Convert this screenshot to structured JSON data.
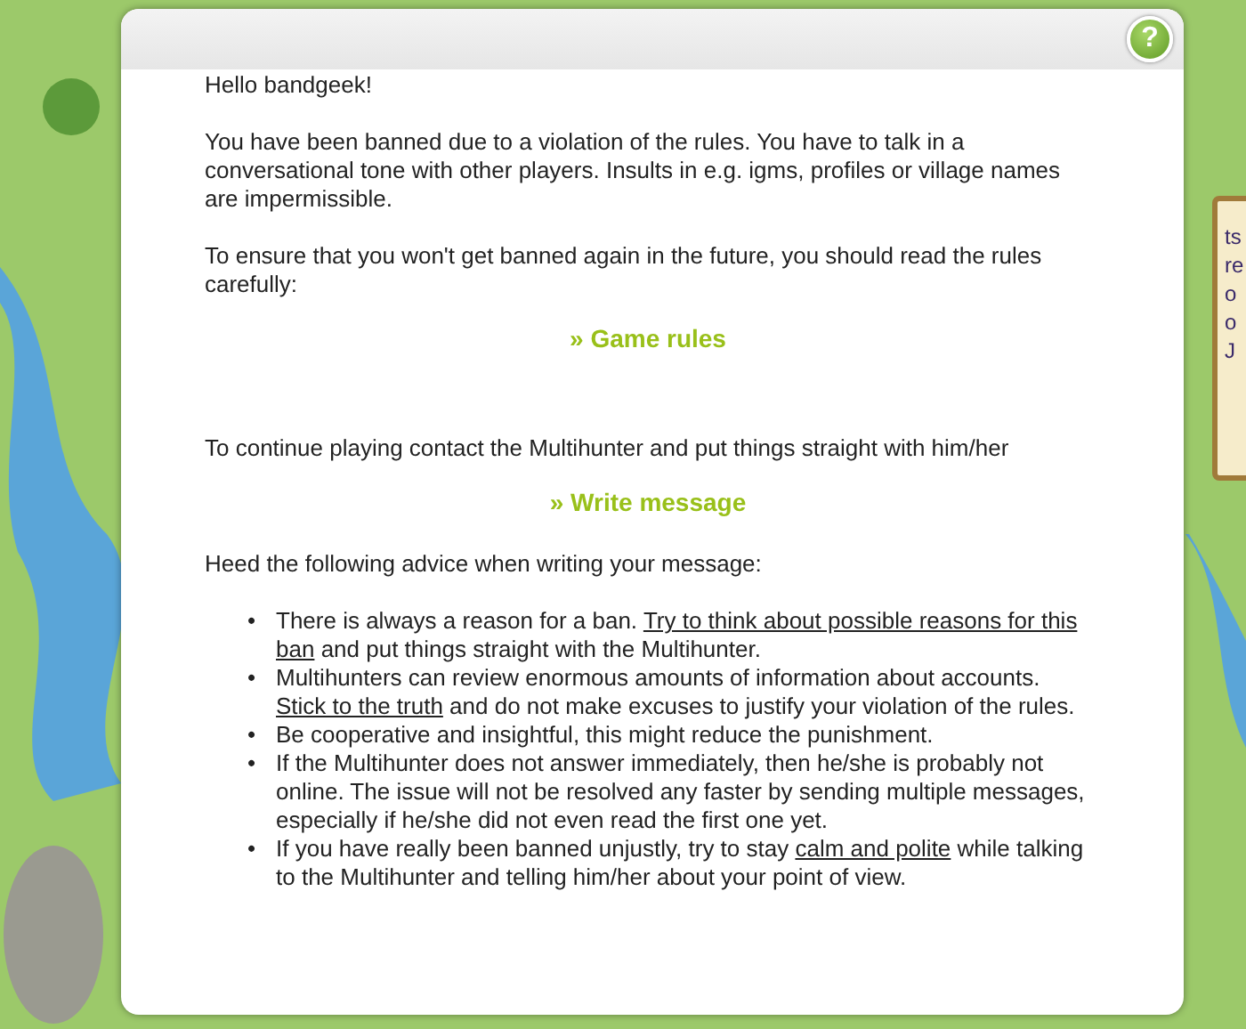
{
  "dialog": {
    "help_button": "?",
    "greeting": "Hello bandgeek!",
    "ban_notice": "You have been banned due to a violation of the rules. You have to talk in a conversational tone with other players. Insults in e.g. igms, profiles or village names are impermissible.",
    "rules_prompt": "To ensure that you won't get banned again in the future, you should read the rules carefully:",
    "rules_link": "» Game rules",
    "contact_prompt": "To continue playing contact the Multihunter and put things straight with him/her",
    "message_link": "» Write message",
    "advice_heading": "Heed the following advice when writing your message:",
    "bullet": "•",
    "advice": [
      [
        {
          "text": "There is always a reason for a ban. ",
          "underline": false
        },
        {
          "text": "Try to think about possible reasons for this ban",
          "underline": true
        },
        {
          "text": " and put things straight with the Multihunter.",
          "underline": false
        }
      ],
      [
        {
          "text": "Multihunters can review enormous amounts of information about accounts. ",
          "underline": false
        },
        {
          "text": "Stick to the truth",
          "underline": true
        },
        {
          "text": " and do not make excuses to justify your violation of the rules.",
          "underline": false
        }
      ],
      [
        {
          "text": "Be cooperative and insightful, this might reduce the punishment.",
          "underline": false
        }
      ],
      [
        {
          "text": "If the Multihunter does not answer immediately, then he/she is probably not online. The issue will not be resolved any faster by sending multiple messages, especially if he/she did not even read the first one yet.",
          "underline": false
        }
      ],
      [
        {
          "text": "If you have really been banned unjustly, try to stay ",
          "underline": false
        },
        {
          "text": "calm and polite",
          "underline": true
        },
        {
          "text": " while talking to the Multihunter and telling him/her about your point of view.",
          "underline": false
        }
      ]
    ]
  },
  "side_panel": {
    "lines": [
      "ts",
      "re",
      "o",
      "o",
      "J"
    ]
  }
}
